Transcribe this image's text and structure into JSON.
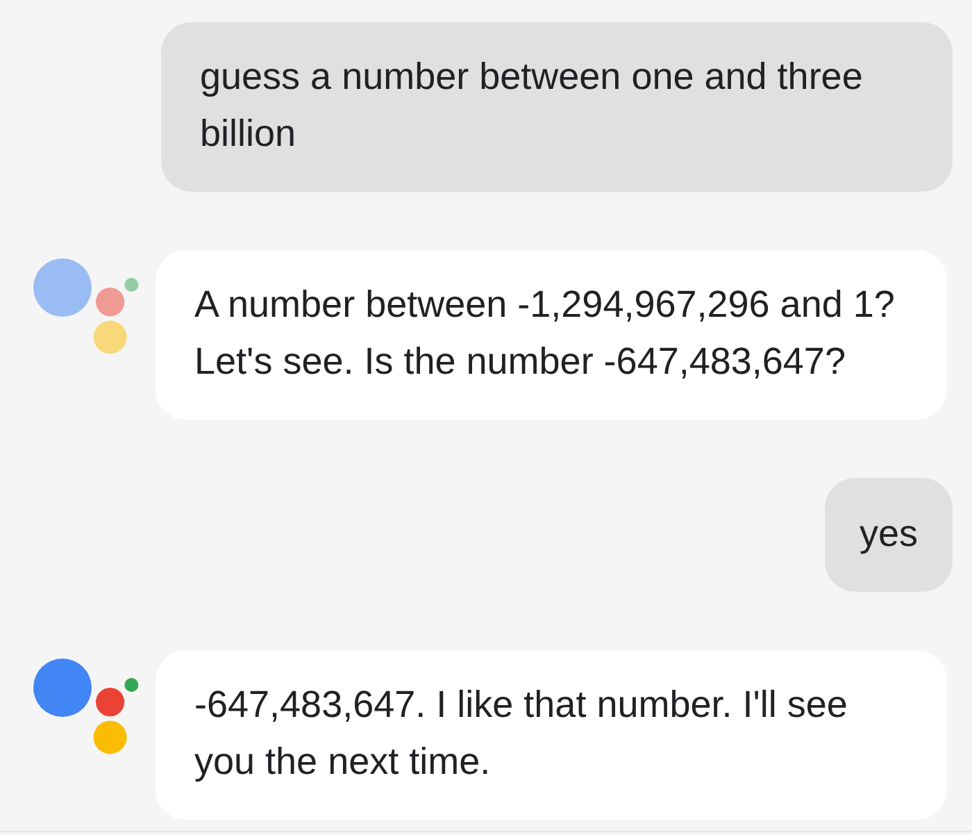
{
  "messages": [
    {
      "kind": "user",
      "lines": [
        "guess a number between one and three",
        "billion"
      ]
    },
    {
      "kind": "assistant",
      "logo_active": false,
      "lines": [
        "A number between -1,294,967,296 and 1?",
        "Let's see. Is the number -647,483,647?"
      ]
    },
    {
      "kind": "user",
      "lines": [
        "yes"
      ]
    },
    {
      "kind": "assistant",
      "logo_active": true,
      "lines": [
        "-647,483,647. I like that number. I'll see",
        "you the next time."
      ]
    }
  ]
}
